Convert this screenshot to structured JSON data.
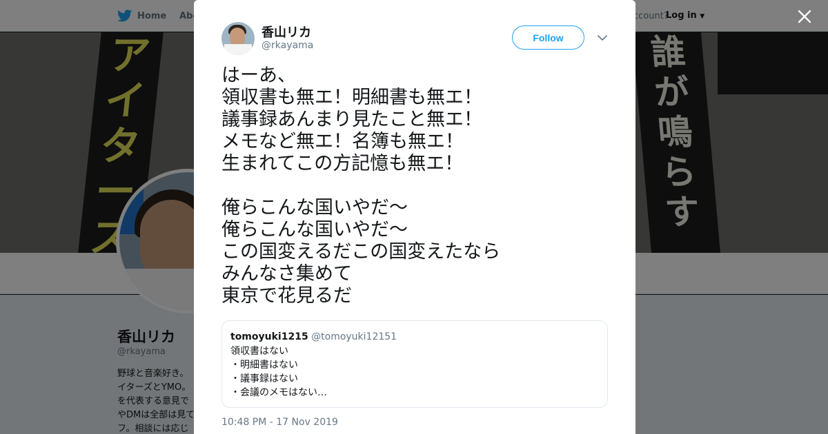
{
  "nav": {
    "home_label": "Home",
    "about_label": "Abo",
    "account_text": "ccount?",
    "login_label": "Log in"
  },
  "banner": {
    "left_text": [
      "ア",
      "イ",
      "タ",
      "ー",
      "ズ"
    ],
    "right_text": [
      "誰",
      "が",
      "鳴",
      "ら",
      "す"
    ]
  },
  "profile": {
    "name": "香山リカ",
    "handle": "@rkayama",
    "bio_lines": [
      "野球と音楽好き。",
      "イターズとYMO。",
      "を代表する意見で",
      "やDMは全部は見て",
      "フ。相談には応じ"
    ]
  },
  "tweet": {
    "author_name": "香山リカ",
    "author_handle": "@rkayama",
    "follow_label": "Follow",
    "text_lines": [
      "はーあ、",
      "領収書も無エ！明細書も無エ！",
      "議事録あんまり見たこと無エ！",
      "メモなど無エ！名簿も無エ！",
      "生まれてこの方記憶も無エ！",
      "",
      "俺らこんな国いやだ～",
      "俺らこんな国いやだ～",
      "この国変えるだこの国変えたなら",
      "みんなさ集めて",
      "東京で花見るだ"
    ],
    "timestamp": "10:48 PM - 17 Nov 2019"
  },
  "quote": {
    "name": "tomoyuki1215",
    "handle": "@tomoyuki12151",
    "lines": [
      "領収書はない",
      "・明細書はない",
      "・議事録はない",
      "・会議のメモはない…"
    ]
  },
  "icons": {
    "bird": "twitter-bird-icon",
    "close": "close-icon",
    "caret": "chevron-down-icon"
  },
  "colors": {
    "accent": "#1da1f2",
    "text": "#14171a",
    "muted": "#657786"
  }
}
